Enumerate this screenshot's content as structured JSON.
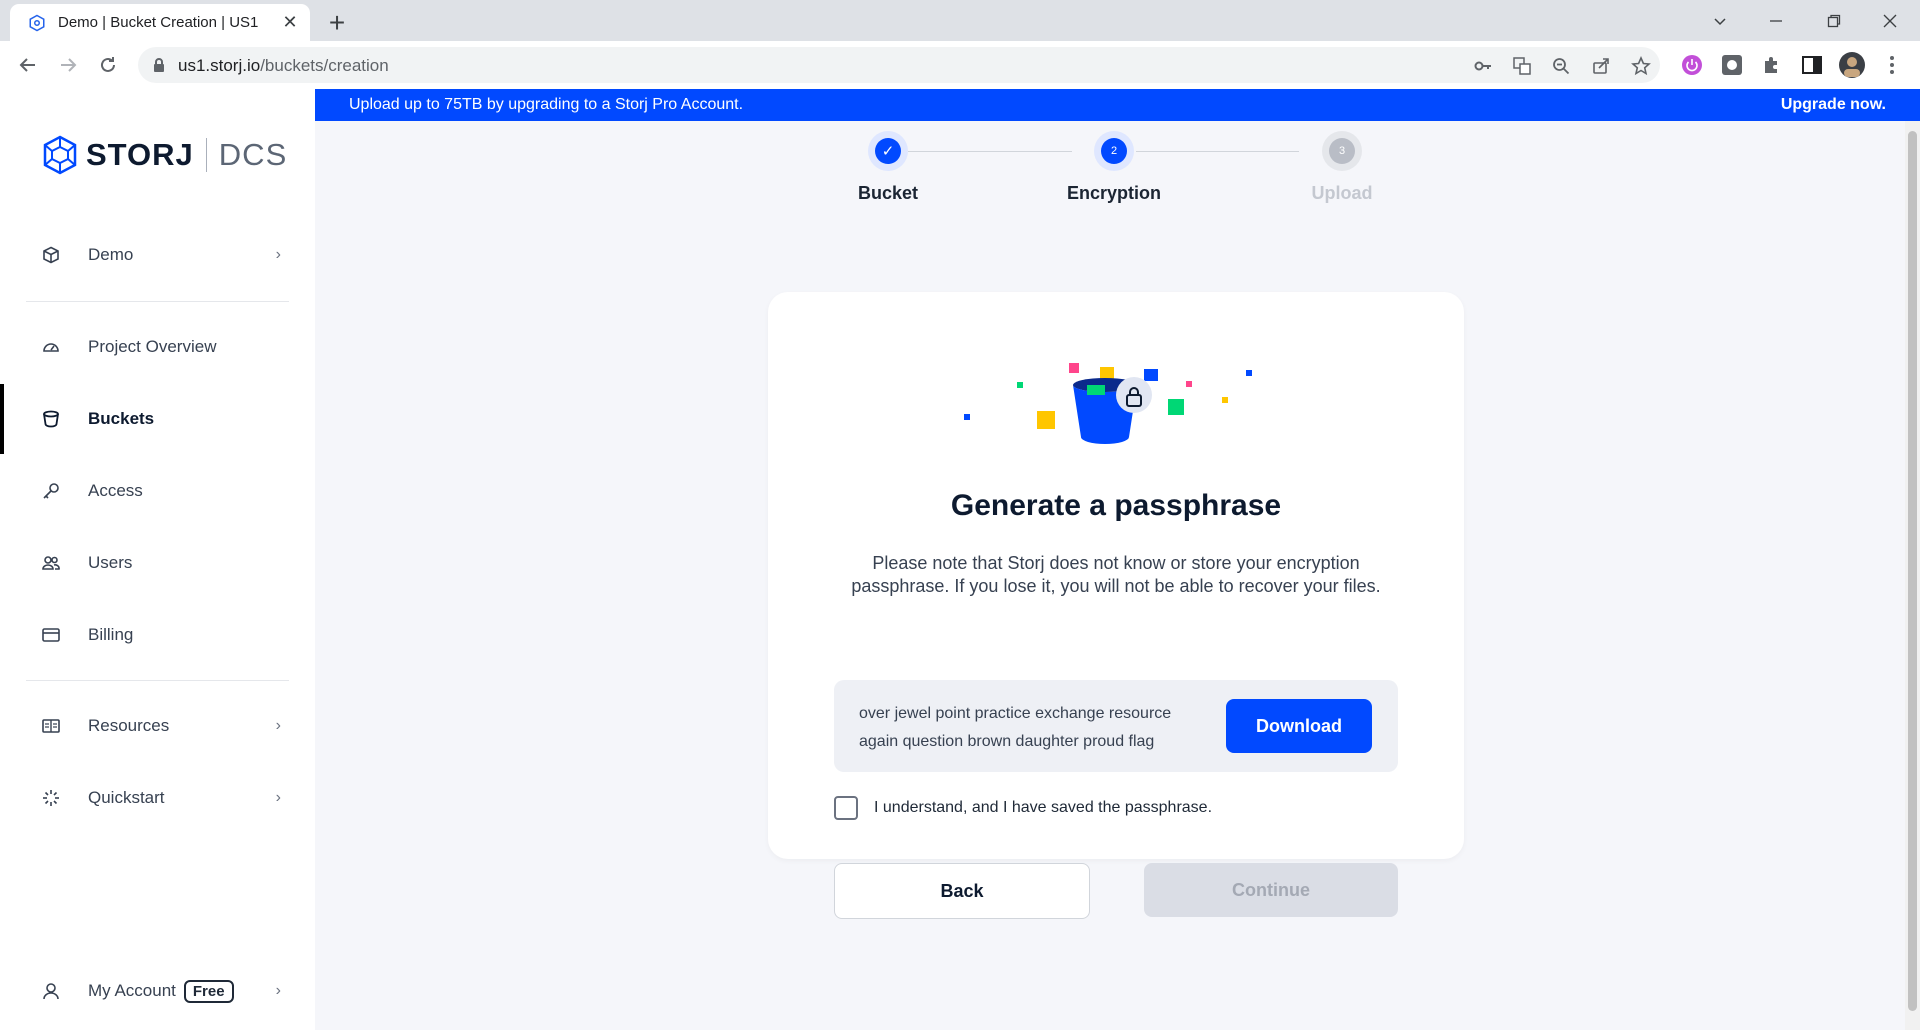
{
  "browser": {
    "tab_title": "Demo | Bucket Creation | US1",
    "tab_close": "✕",
    "new_tab": "+",
    "url_host": "us1.storj.io",
    "url_path": "/buckets/creation"
  },
  "banner": {
    "message": "Upload up to 75TB by upgrading to a Storj Pro Account.",
    "cta": "Upgrade now."
  },
  "logo": {
    "brand": "STORJ",
    "product": "DCS"
  },
  "sidebar": {
    "project": "Demo",
    "items": [
      {
        "label": "Project Overview"
      },
      {
        "label": "Buckets"
      },
      {
        "label": "Access"
      },
      {
        "label": "Users"
      },
      {
        "label": "Billing"
      }
    ],
    "resources": "Resources",
    "quickstart": "Quickstart",
    "account": "My Account",
    "account_badge": "Free",
    "chevron": "›"
  },
  "stepper": {
    "steps": [
      {
        "label": "Bucket",
        "marker": "✓"
      },
      {
        "label": "Encryption",
        "marker": "2"
      },
      {
        "label": "Upload",
        "marker": "3"
      }
    ]
  },
  "card": {
    "title": "Generate a passphrase",
    "description": "Please note that Storj does not know or store your encryption passphrase. If you lose it, you will not be able to recover your files.",
    "passphrase": "over jewel point practice exchange resource again question brown daughter proud flag",
    "download_label": "Download",
    "ack_label": "I understand, and I have saved the passphrase.",
    "back_label": "Back",
    "continue_label": "Continue"
  },
  "colors": {
    "brand_blue": "#0149ff",
    "disabled": "#dadde5"
  }
}
